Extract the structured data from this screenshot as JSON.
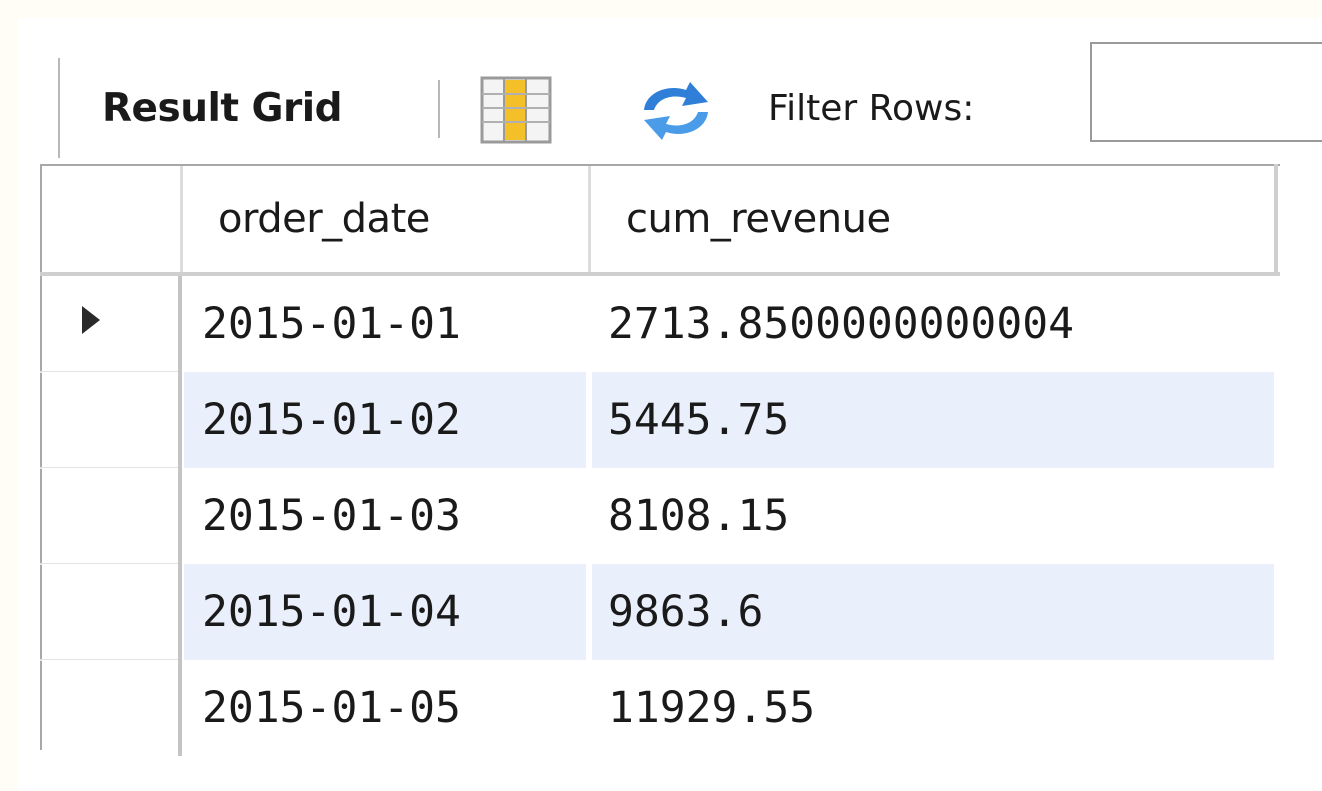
{
  "toolbar": {
    "result_grid_label": "Result Grid",
    "filter_rows_label": "Filter Rows:",
    "filter_value": "",
    "icons": {
      "grid_toggle": "grid-columns-icon",
      "refresh": "refresh-icon"
    }
  },
  "grid": {
    "columns": [
      "order_date",
      "cum_revenue"
    ],
    "rows": [
      {
        "order_date": "2015-01-01",
        "cum_revenue": "2713.8500000000004"
      },
      {
        "order_date": "2015-01-02",
        "cum_revenue": "5445.75"
      },
      {
        "order_date": "2015-01-03",
        "cum_revenue": "8108.15"
      },
      {
        "order_date": "2015-01-04",
        "cum_revenue": "9863.6"
      },
      {
        "order_date": "2015-01-05",
        "cum_revenue": "11929.55"
      }
    ],
    "current_row_index": 0
  },
  "colors": {
    "alt_row": "#e9f0fb",
    "refresh_blue": "#2f7fd8",
    "grid_icon_yellow": "#f3c02a"
  }
}
